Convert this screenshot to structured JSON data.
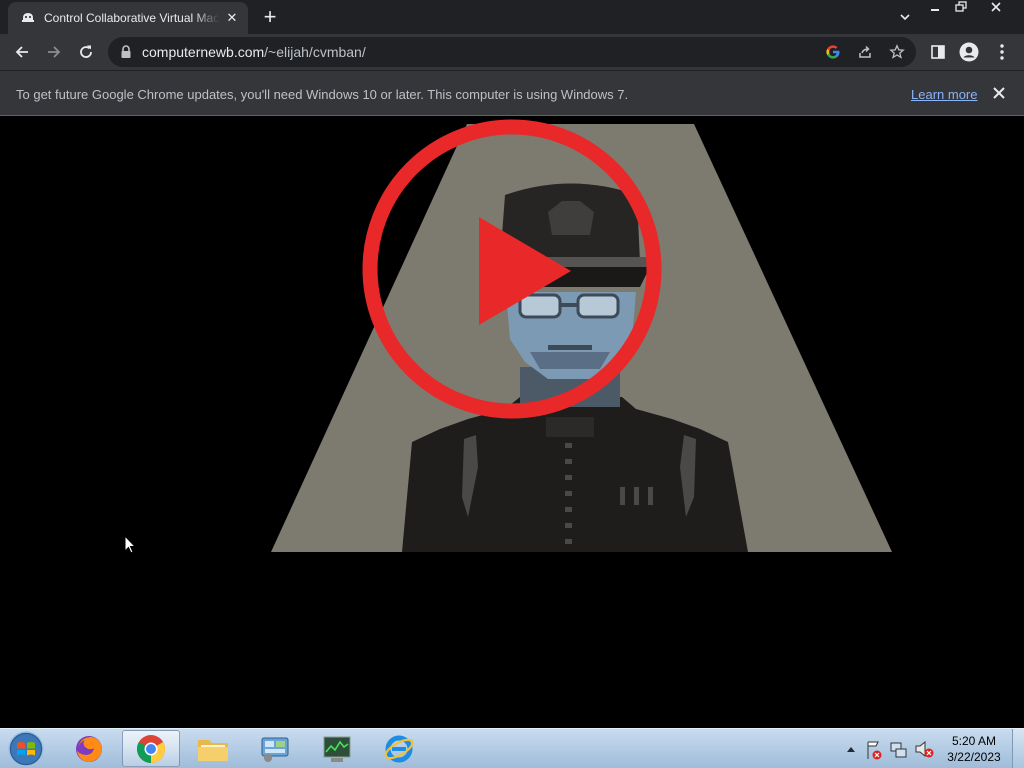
{
  "browser": {
    "tab": {
      "title": "Control Collaborative Virtual Machine"
    },
    "address": {
      "host": "computernewb.com",
      "path": "/~elijah/cvmban/"
    },
    "infobar": {
      "message": "To get future Google Chrome updates, you'll need Windows 10 or later. This computer is using Windows 7.",
      "link_label": "Learn more"
    }
  },
  "icons": {
    "tab_favicon": "helmet-icon",
    "tab_close": "close-icon",
    "new_tab": "plus-icon",
    "tab_search": "chevron-down-icon",
    "back": "arrow-left-icon",
    "forward": "arrow-right-icon",
    "reload": "reload-icon",
    "lock": "lock-icon",
    "google": "google-icon",
    "share": "share-icon",
    "bookmark": "star-icon",
    "side_panel": "side-panel-icon",
    "profile": "profile-icon",
    "menu": "kebab-menu-icon"
  },
  "page": {
    "media": "pixel-art officer under spotlight with play button overlay"
  },
  "taskbar": {
    "pinned": [
      "Firefox",
      "Google Chrome",
      "Windows Explorer",
      "Control Panel",
      "Task Manager",
      "Internet Explorer"
    ],
    "clock": {
      "time": "5:20 AM",
      "date": "3/22/2023"
    }
  },
  "colors": {
    "chrome_dark": "#202124",
    "chrome_toolbar": "#35363a",
    "link": "#8ab4f8",
    "play_red": "#e9282a",
    "spotlight": "#7d7b70",
    "face": "#7d9ab5"
  }
}
